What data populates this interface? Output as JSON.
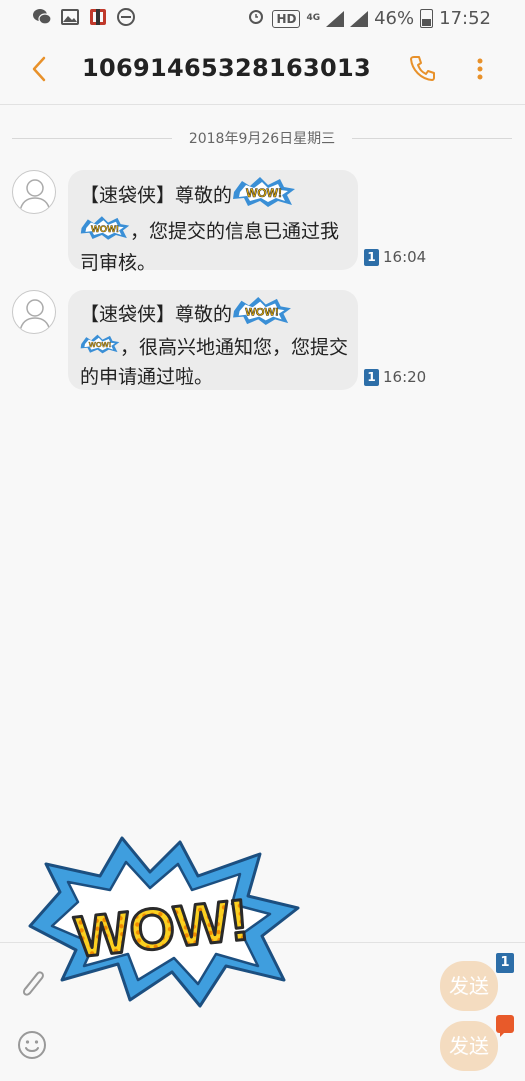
{
  "status_bar": {
    "hd_label": "HD",
    "network_label": "4G",
    "battery": "46%",
    "time": "17:52"
  },
  "header": {
    "title": "10691465328163013"
  },
  "thread": {
    "date": "2018年9月26日星期三",
    "messages": [
      {
        "part1": "【速袋侠】尊敬的",
        "part2": "，您提交的信息已通过我司审核。",
        "sim": "1",
        "time": "16:04"
      },
      {
        "part1": "【速袋侠】尊敬的",
        "part2": "，很高兴地通知您，您提交的申请通过啦。",
        "sim": "1",
        "time": "16:20"
      }
    ]
  },
  "sticker": {
    "text": "WOW!"
  },
  "compose": {
    "send1_label": "发送",
    "send1_sim": "1",
    "send2_label": "发送"
  },
  "colors": {
    "accent": "#e8912a",
    "bubble": "#ececec",
    "sim": "#2d6ea8",
    "send_button": "#f4dcc0"
  },
  "icons": {
    "back": "chevron-left-icon",
    "call": "phone-icon",
    "more": "more-vertical-icon",
    "attach": "paperclip-icon",
    "emoji": "smiley-icon",
    "avatar": "person-icon"
  }
}
